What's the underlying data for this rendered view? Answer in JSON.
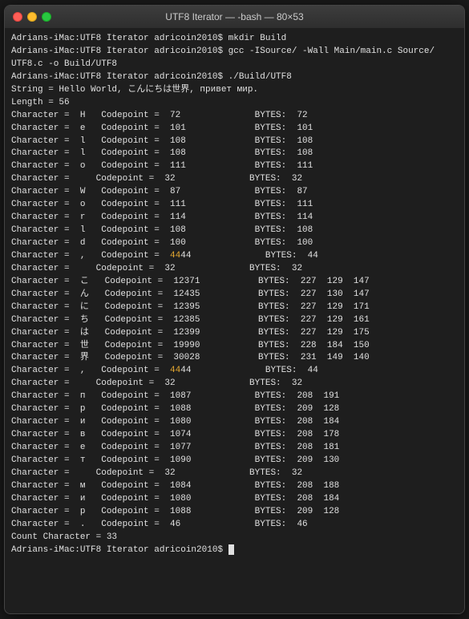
{
  "window": {
    "title": "UTF8 Iterator — -bash — 80×53"
  },
  "terminal": {
    "lines": [
      {
        "id": "l1",
        "text": "Adrians-iMac:UTF8 Iterator adricoin2010$ mkdir Build"
      },
      {
        "id": "l2",
        "text": "Adrians-iMac:UTF8 Iterator adricoin2010$ gcc -ISource/ -Wall Main/main.c Source/"
      },
      {
        "id": "l3",
        "text": "UTF8.c -o Build/UTF8"
      },
      {
        "id": "l4",
        "text": "Adrians-iMac:UTF8 Iterator adricoin2010$ ./Build/UTF8"
      },
      {
        "id": "l5",
        "text": ""
      },
      {
        "id": "l6",
        "text": "String = Hello World, こんにちは世界, привет мир."
      },
      {
        "id": "l7",
        "text": "Length = 56"
      },
      {
        "id": "l8",
        "text": ""
      },
      {
        "id": "l9",
        "text": "Character =  H   Codepoint =  72              BYTES:  72"
      },
      {
        "id": "l10",
        "text": "Character =  e   Codepoint =  101             BYTES:  101"
      },
      {
        "id": "l11",
        "text": "Character =  l   Codepoint =  108             BYTES:  108"
      },
      {
        "id": "l12",
        "text": "Character =  l   Codepoint =  108             BYTES:  108"
      },
      {
        "id": "l13",
        "text": "Character =  o   Codepoint =  111             BYTES:  111"
      },
      {
        "id": "l14",
        "text": "Character =     Codepoint =  32              BYTES:  32"
      },
      {
        "id": "l15",
        "text": "Character =  W   Codepoint =  87              BYTES:  87"
      },
      {
        "id": "l16",
        "text": "Character =  o   Codepoint =  111             BYTES:  111"
      },
      {
        "id": "l17",
        "text": "Character =  r   Codepoint =  114             BYTES:  114"
      },
      {
        "id": "l18",
        "text": "Character =  l   Codepoint =  108             BYTES:  108"
      },
      {
        "id": "l19",
        "text": "Character =  d   Codepoint =  100             BYTES:  100"
      },
      {
        "id": "l20",
        "text": "Character =  ,   Codepoint =  44              BYTES:  44",
        "has_orange": true,
        "orange_text": "44"
      },
      {
        "id": "l21",
        "text": "Character =     Codepoint =  32              BYTES:  32"
      },
      {
        "id": "l22",
        "text": "Character =  こ   Codepoint =  12371           BYTES:  227  129  147"
      },
      {
        "id": "l23",
        "text": "Character =  ん   Codepoint =  12435           BYTES:  227  130  147"
      },
      {
        "id": "l24",
        "text": "Character =  に   Codepoint =  12395           BYTES:  227  129  171"
      },
      {
        "id": "l25",
        "text": "Character =  ち   Codepoint =  12385           BYTES:  227  129  161"
      },
      {
        "id": "l26",
        "text": "Character =  は   Codepoint =  12399           BYTES:  227  129  175"
      },
      {
        "id": "l27",
        "text": "Character =  世   Codepoint =  19990           BYTES:  228  184  150"
      },
      {
        "id": "l28",
        "text": "Character =  界   Codepoint =  30028           BYTES:  231  149  140"
      },
      {
        "id": "l29",
        "text": "Character =  ,   Codepoint =  44              BYTES:  44",
        "has_orange": true,
        "orange_text": "44"
      },
      {
        "id": "l30",
        "text": "Character =     Codepoint =  32              BYTES:  32"
      },
      {
        "id": "l31",
        "text": "Character =  п   Codepoint =  1087            BYTES:  208  191"
      },
      {
        "id": "l32",
        "text": "Character =  р   Codepoint =  1088            BYTES:  209  128"
      },
      {
        "id": "l33",
        "text": "Character =  и   Codepoint =  1080            BYTES:  208  184"
      },
      {
        "id": "l34",
        "text": "Character =  в   Codepoint =  1074            BYTES:  208  178"
      },
      {
        "id": "l35",
        "text": "Character =  е   Codepoint =  1077            BYTES:  208  181"
      },
      {
        "id": "l36",
        "text": "Character =  т   Codepoint =  1090            BYTES:  209  130"
      },
      {
        "id": "l37",
        "text": "Character =     Codepoint =  32              BYTES:  32"
      },
      {
        "id": "l38",
        "text": "Character =  м   Codepoint =  1084            BYTES:  208  188"
      },
      {
        "id": "l39",
        "text": "Character =  и   Codepoint =  1080            BYTES:  208  184"
      },
      {
        "id": "l40",
        "text": "Character =  р   Codepoint =  1088            BYTES:  209  128"
      },
      {
        "id": "l41",
        "text": "Character =  .   Codepoint =  46              BYTES:  46"
      },
      {
        "id": "l42",
        "text": ""
      },
      {
        "id": "l43",
        "text": "Count Character = 33"
      },
      {
        "id": "l44",
        "text": "Adrians-iMac:UTF8 Iterator adricoin2010$ "
      }
    ]
  }
}
